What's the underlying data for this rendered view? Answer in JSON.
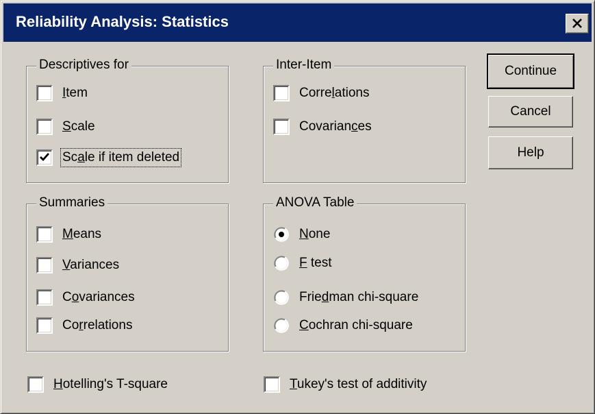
{
  "window": {
    "title": "Reliability Analysis: Statistics",
    "title_bar_color": "#0a246a",
    "face_color": "#d4d0c8"
  },
  "descriptives": {
    "legend": "Descriptives for",
    "items": [
      {
        "pre": "",
        "key": "I",
        "post": "tem",
        "checked": false
      },
      {
        "pre": "",
        "key": "S",
        "post": "cale",
        "checked": false
      },
      {
        "pre": "Sc",
        "key": "a",
        "post": "le if item deleted",
        "checked": true
      }
    ]
  },
  "inter_item": {
    "legend": "Inter-Item",
    "items": [
      {
        "pre": "Corre",
        "key": "l",
        "post": "ations",
        "checked": false
      },
      {
        "pre": "Covarian",
        "key": "c",
        "post": "es",
        "checked": false
      }
    ]
  },
  "summaries": {
    "legend": "Summaries",
    "items": [
      {
        "pre": "",
        "key": "M",
        "post": "eans",
        "checked": false
      },
      {
        "pre": "",
        "key": "V",
        "post": "ariances",
        "checked": false
      },
      {
        "pre": "C",
        "key": "o",
        "post": "variances",
        "checked": false
      },
      {
        "pre": "Co",
        "key": "r",
        "post": "relations",
        "checked": false
      }
    ]
  },
  "anova": {
    "legend": "ANOVA Table",
    "selected": "None",
    "items": [
      {
        "pre": "",
        "key": "N",
        "post": "one",
        "selected": true
      },
      {
        "pre": "",
        "key": "F",
        "post": " test",
        "selected": false
      },
      {
        "pre": "Frie",
        "key": "d",
        "post": "man chi-square",
        "selected": false
      },
      {
        "pre": "",
        "key": "C",
        "post": "ochran chi-square",
        "selected": false
      }
    ]
  },
  "bottom": {
    "hotelling": {
      "pre": "",
      "key": "H",
      "post": "otelling's T-square",
      "checked": false
    },
    "tukey": {
      "pre": "",
      "key": "T",
      "post": "ukey's test of additivity",
      "checked": false
    }
  },
  "buttons": {
    "continue": "Continue",
    "cancel": "Cancel",
    "help": "Help"
  },
  "icons": {
    "close": "close-icon",
    "check": "checkmark-icon",
    "radio_dot": "radio-dot-icon"
  }
}
